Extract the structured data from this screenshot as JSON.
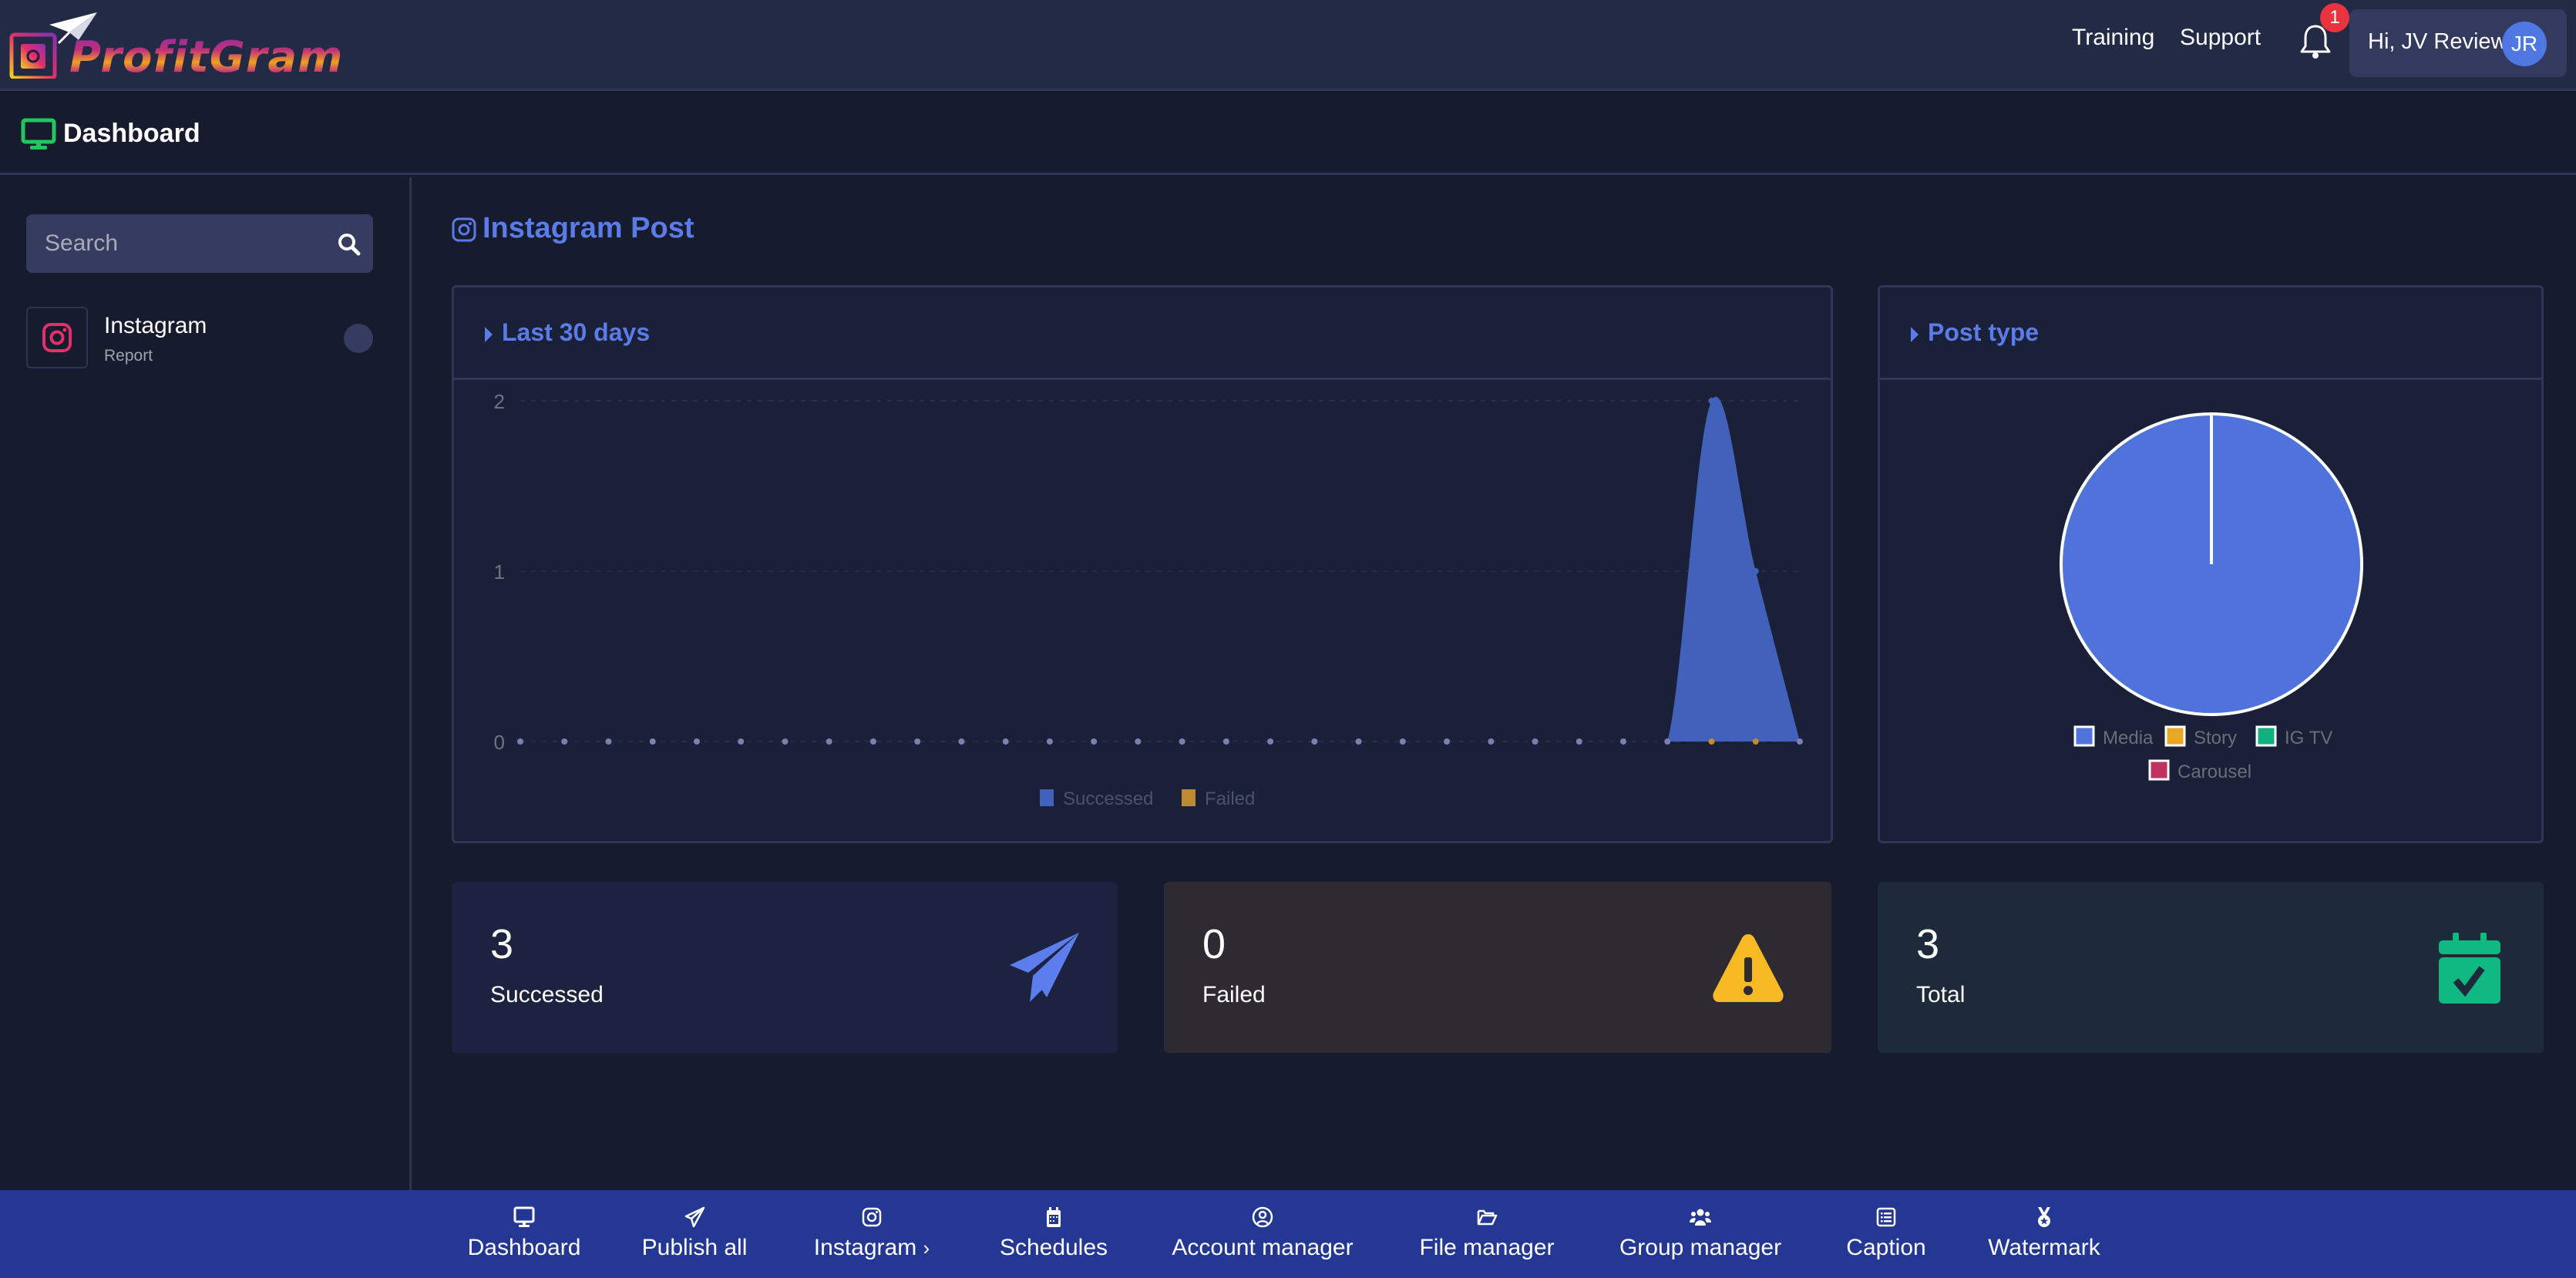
{
  "header": {
    "brand": "ProfitGram",
    "links": [
      {
        "label": "Training"
      },
      {
        "label": "Support"
      }
    ],
    "notifications_count": "1",
    "user_greeting": "Hi, JV Review",
    "user_initials": "JR"
  },
  "subheader": {
    "title": "Dashboard",
    "icon": "monitor-icon"
  },
  "sidebar": {
    "search_placeholder": "Search",
    "accounts": [
      {
        "name": "Instagram",
        "subtitle": "Report",
        "icon": "instagram-icon"
      }
    ]
  },
  "main": {
    "section_title": "Instagram Post",
    "line_card_title": "Last 30 days",
    "pie_card_title": "Post type",
    "stats": [
      {
        "value": "3",
        "label": "Successed",
        "icon": "paper-plane-icon",
        "color": "#4f78e3",
        "bg": "#1c2240"
      },
      {
        "value": "0",
        "label": "Failed",
        "icon": "warning-icon",
        "color": "#f7b924",
        "bg": "#2e2a31"
      },
      {
        "value": "3",
        "label": "Total",
        "icon": "calendar-check-icon",
        "color": "#10b77f",
        "bg": "#1c2a3a"
      }
    ]
  },
  "chart_data": [
    {
      "type": "area",
      "title": "Last 30 days",
      "xlabel": "",
      "ylabel": "",
      "ylim": [
        0,
        2
      ],
      "yticks": [
        "0",
        "1",
        "2"
      ],
      "x_count": 30,
      "grid": true,
      "legend_position": "bottom",
      "series": [
        {
          "name": "Successed",
          "color": "#4261ba",
          "values": [
            0,
            0,
            0,
            0,
            0,
            0,
            0,
            0,
            0,
            0,
            0,
            0,
            0,
            0,
            0,
            0,
            0,
            0,
            0,
            0,
            0,
            0,
            0,
            0,
            0,
            0,
            0,
            2,
            1,
            0
          ]
        },
        {
          "name": "Failed",
          "color": "#c08b30",
          "values": [
            0,
            0,
            0,
            0,
            0,
            0,
            0,
            0,
            0,
            0,
            0,
            0,
            0,
            0,
            0,
            0,
            0,
            0,
            0,
            0,
            0,
            0,
            0,
            0,
            0,
            0,
            0,
            0,
            0,
            0
          ]
        }
      ]
    },
    {
      "type": "pie",
      "title": "Post type",
      "legend_position": "bottom",
      "categories": [
        "Media",
        "Story",
        "IG TV",
        "Carousel"
      ],
      "values": [
        3,
        0,
        0,
        0
      ],
      "colors": [
        "#5073db",
        "#e9a823",
        "#10b080",
        "#c0325f"
      ]
    }
  ],
  "bottom_nav": [
    {
      "label": "Dashboard",
      "icon": "monitor-icon"
    },
    {
      "label": "Publish all",
      "icon": "paper-plane-icon"
    },
    {
      "label": "Instagram",
      "icon": "instagram-icon",
      "has_submenu": true,
      "chevron": "›"
    },
    {
      "label": "Schedules",
      "icon": "calendar-icon"
    },
    {
      "label": "Account manager",
      "icon": "user-circle-icon"
    },
    {
      "label": "File manager",
      "icon": "folder-open-icon"
    },
    {
      "label": "Group manager",
      "icon": "users-icon"
    },
    {
      "label": "Caption",
      "icon": "list-alt-icon"
    },
    {
      "label": "Watermark",
      "icon": "medal-icon"
    }
  ]
}
